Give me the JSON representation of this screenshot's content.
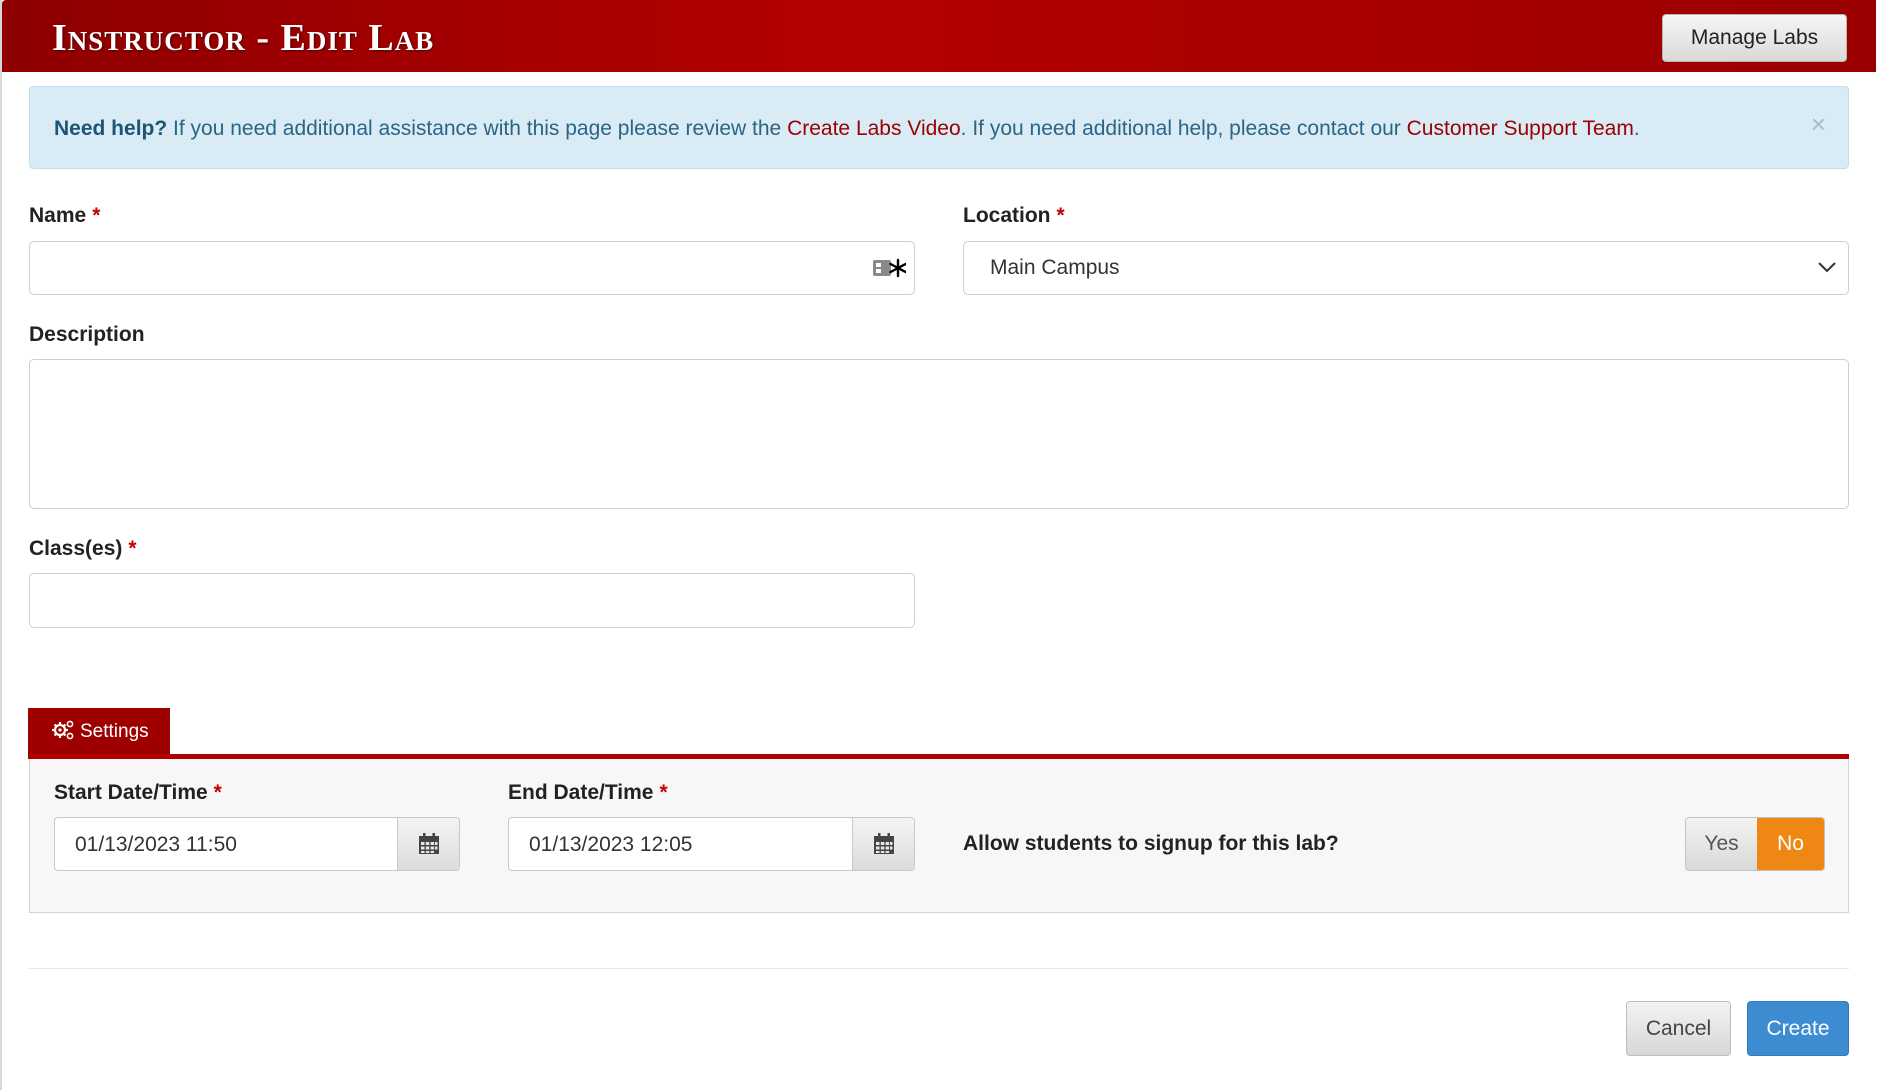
{
  "header": {
    "title": "Instructor - Edit Lab",
    "manage_labs_label": "Manage Labs"
  },
  "alert": {
    "lead": "Need help?",
    "text1": " If you need additional assistance with this page please review the ",
    "link1": "Create Labs Video",
    "text2": ". If you need additional help, please contact our ",
    "link2": "Customer Support Team",
    "text3": ".",
    "close_glyph": "×"
  },
  "form": {
    "name": {
      "label": "Name",
      "required": "*",
      "value": ""
    },
    "location": {
      "label": "Location",
      "required": "*",
      "value": "Main Campus"
    },
    "description": {
      "label": "Description",
      "value": ""
    },
    "classes": {
      "label": "Class(es)",
      "required": "*",
      "value": ""
    }
  },
  "settings": {
    "tab_label": "Settings",
    "start": {
      "label": "Start Date/Time",
      "required": "*",
      "value": "01/13/2023 11:50"
    },
    "end": {
      "label": "End Date/Time",
      "required": "*",
      "value": "01/13/2023 12:05"
    },
    "signup_question": "Allow students to signup for this lab?",
    "signup_yes": "Yes",
    "signup_no": "No",
    "signup_selected": "No"
  },
  "actions": {
    "cancel_label": "Cancel",
    "create_label": "Create"
  },
  "colors": {
    "brand_red": "#b00000",
    "toggle_active": "#ee8714",
    "primary_button": "#3d8bd1",
    "alert_bg": "#d9ecf5"
  }
}
